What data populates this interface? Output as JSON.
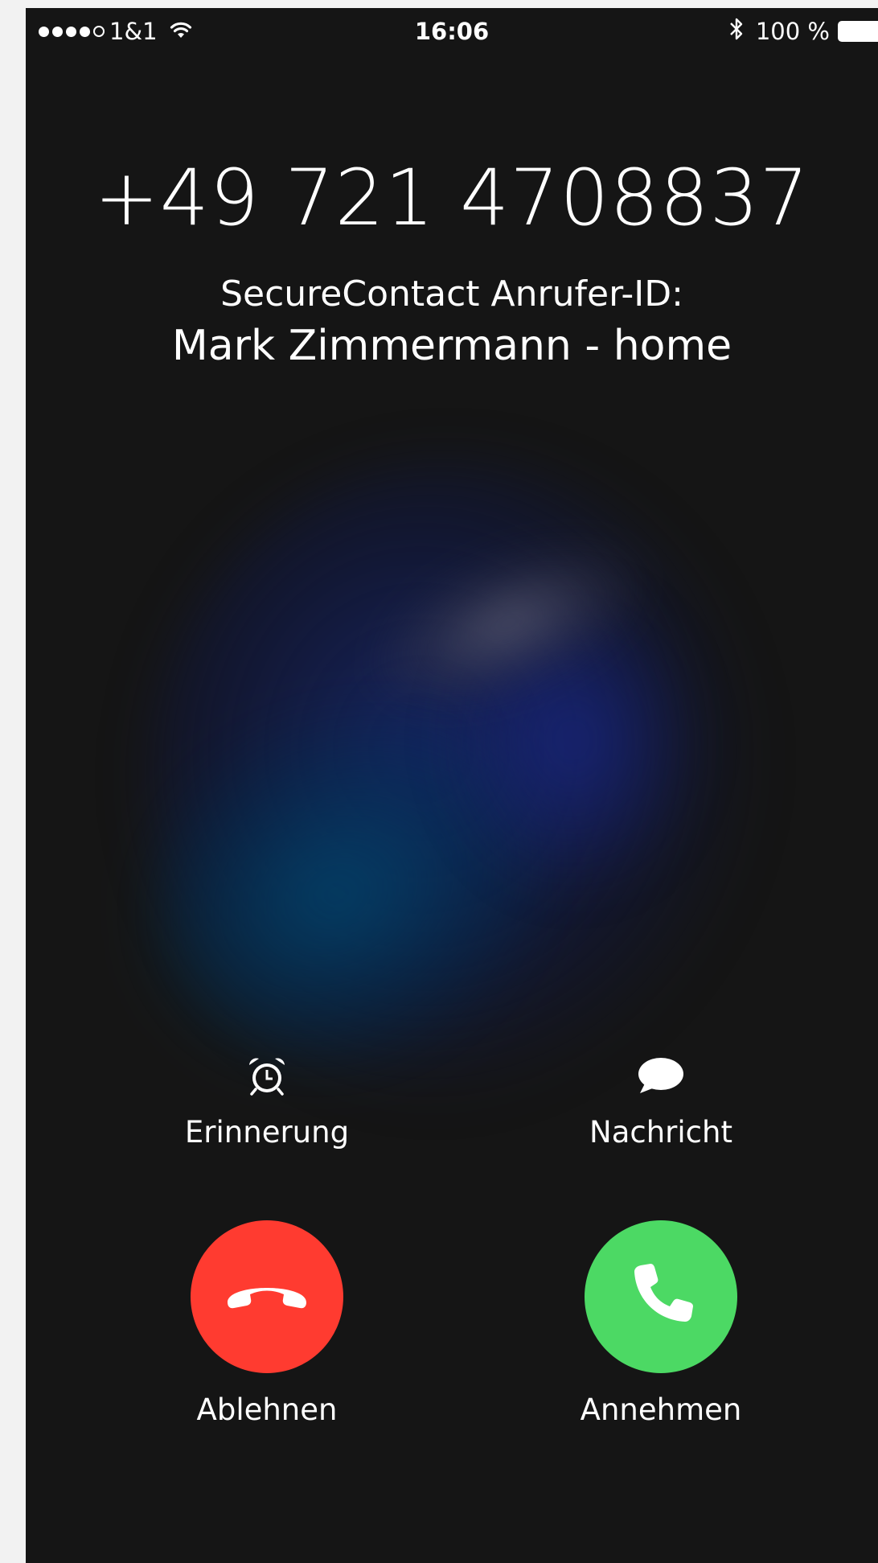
{
  "status_bar": {
    "carrier": "1&1",
    "time": "16:06",
    "battery": "100 %",
    "icons": [
      "signal-dots",
      "wifi-icon",
      "bluetooth-icon",
      "battery-icon"
    ]
  },
  "call": {
    "number": "+49 721 4708837",
    "caller_id_label": "SecureContact Anrufer-ID:",
    "caller_name": "Mark Zimmermann - home"
  },
  "actions": {
    "remind_label": "Erinnerung",
    "message_label": "Nachricht",
    "decline_label": "Ablehnen",
    "accept_label": "Annehmen"
  },
  "colors": {
    "background": "#151515",
    "decline": "#ff3b30",
    "accept": "#4cd964"
  }
}
